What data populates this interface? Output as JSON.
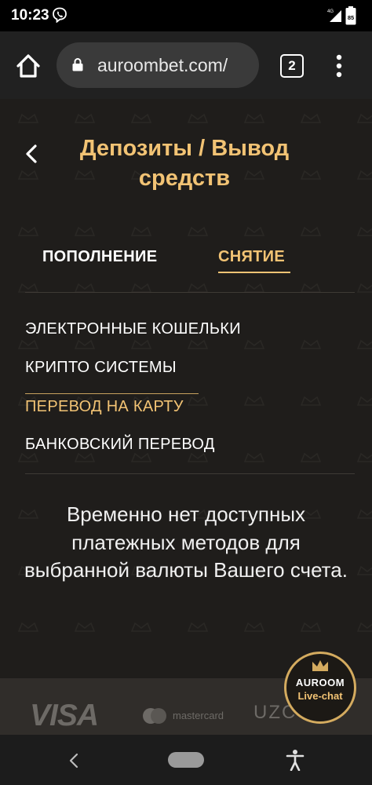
{
  "status": {
    "time": "10:23",
    "network": "4G",
    "battery": "85"
  },
  "browser": {
    "url": "auroombet.com/",
    "tab_count": "2"
  },
  "page": {
    "title_line1": "Депозиты / Вывод",
    "title_line2": "средств",
    "tabs": [
      {
        "label": "ПОПОЛНЕНИЕ",
        "active": false
      },
      {
        "label": "СНЯТИЕ",
        "active": true
      }
    ],
    "methods": [
      {
        "label": "ЭЛЕКТРОННЫЕ КОШЕЛЬКИ",
        "active": false
      },
      {
        "label": "КРИПТО СИСТЕМЫ",
        "active": false
      },
      {
        "label": "ПЕРЕВОД НА КАРТУ",
        "active": true
      },
      {
        "label": "БАНКОВСКИЙ ПЕРЕВОД",
        "active": false
      }
    ],
    "notice": "Временно нет доступных платежных методов для выбранной валюты Вашего счета."
  },
  "footer": {
    "visa": "VISA",
    "mastercard": "mastercard",
    "uzcard": "UZC"
  },
  "live_chat": {
    "title": "AUROOM",
    "subtitle": "Live-chat"
  },
  "colors": {
    "accent": "#f2c374",
    "page_bg": "#1f1d1b",
    "toolbar_bg": "#212121"
  }
}
